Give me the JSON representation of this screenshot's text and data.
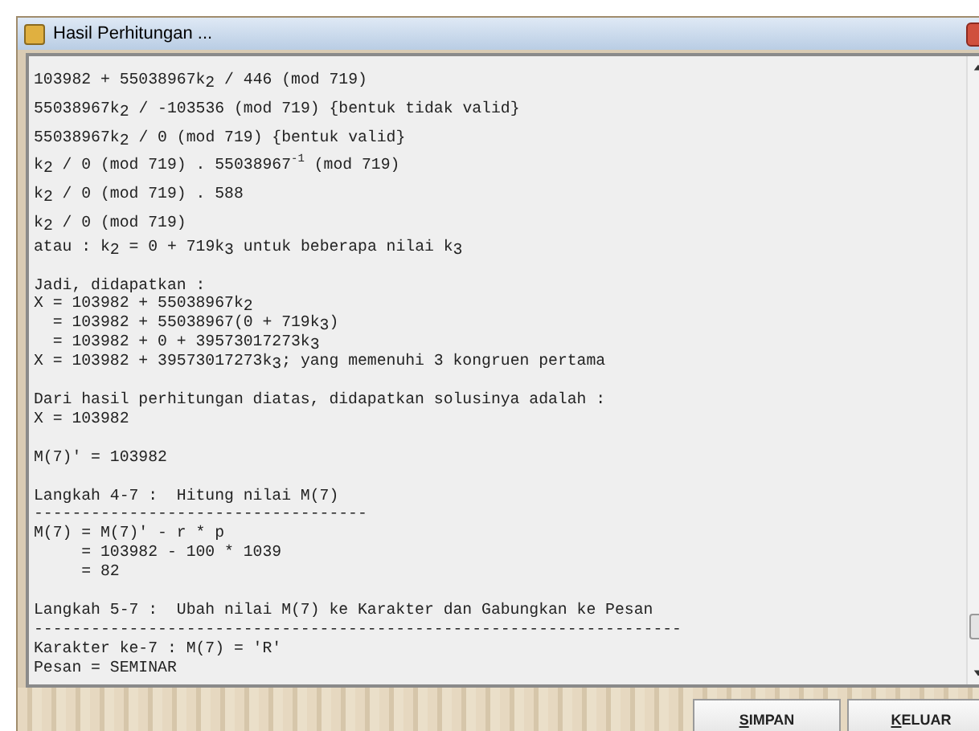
{
  "window": {
    "title": "Hasil Perhitungan ..."
  },
  "output_lines": [
    {
      "kind": "formula",
      "text": "103982 + 55038967k$_{2}$ / 446 (mod 719)"
    },
    {
      "kind": "formula",
      "text": "55038967k$_{2}$ / -103536 (mod 719) {bentuk tidak valid}"
    },
    {
      "kind": "formula",
      "text": "55038967k$_{2}$ / 0 (mod 719) {bentuk valid}"
    },
    {
      "kind": "formula",
      "text": "k$_{2}$ / 0 (mod 719) . 55038967$^{-1}$ (mod 719)"
    },
    {
      "kind": "formula",
      "text": "k$_{2}$ / 0 (mod 719) . 588"
    },
    {
      "kind": "formula",
      "text": "k$_{2}$ / 0 (mod 719)"
    },
    {
      "kind": "plain",
      "text": "atau : k$_{2}$ = 0 + 719k$_{3}$ untuk beberapa nilai k$_{3}$"
    },
    {
      "kind": "blank"
    },
    {
      "kind": "plain",
      "text": "Jadi, didapatkan :"
    },
    {
      "kind": "plain",
      "text": "X = 103982 + 55038967k$_{2}$"
    },
    {
      "kind": "plain",
      "text": "  = 103982 + 55038967(0 + 719k$_{3}$)"
    },
    {
      "kind": "plain",
      "text": "  = 103982 + 0 + 39573017273k$_{3}$"
    },
    {
      "kind": "plain",
      "text": "X = 103982 + 39573017273k$_{3}$; yang memenuhi 3 kongruen pertama"
    },
    {
      "kind": "blank"
    },
    {
      "kind": "plain",
      "text": "Dari hasil perhitungan diatas, didapatkan solusinya adalah :"
    },
    {
      "kind": "plain",
      "text": "X = 103982"
    },
    {
      "kind": "blank"
    },
    {
      "kind": "plain",
      "text": "M(7)' = 103982"
    },
    {
      "kind": "blank"
    },
    {
      "kind": "plain",
      "text": "Langkah 4-7 :  Hitung nilai M(7)"
    },
    {
      "kind": "plain",
      "text": "-----------------------------------"
    },
    {
      "kind": "plain",
      "text": "M(7) = M(7)' - r * p"
    },
    {
      "kind": "plain",
      "text": "     = 103982 - 100 * 1039"
    },
    {
      "kind": "plain",
      "text": "     = 82"
    },
    {
      "kind": "blank"
    },
    {
      "kind": "plain",
      "text": "Langkah 5-7 :  Ubah nilai M(7) ke Karakter dan Gabungkan ke Pesan"
    },
    {
      "kind": "plain",
      "text": "--------------------------------------------------------------------"
    },
    {
      "kind": "plain",
      "text": "Karakter ke-7 : M(7) = 'R'"
    },
    {
      "kind": "plain",
      "text": "Pesan = SEMINAR"
    }
  ],
  "buttons": [
    {
      "label": "SIMPAN",
      "underline_first": true
    },
    {
      "label": "KELUAR",
      "underline_first": true
    }
  ]
}
